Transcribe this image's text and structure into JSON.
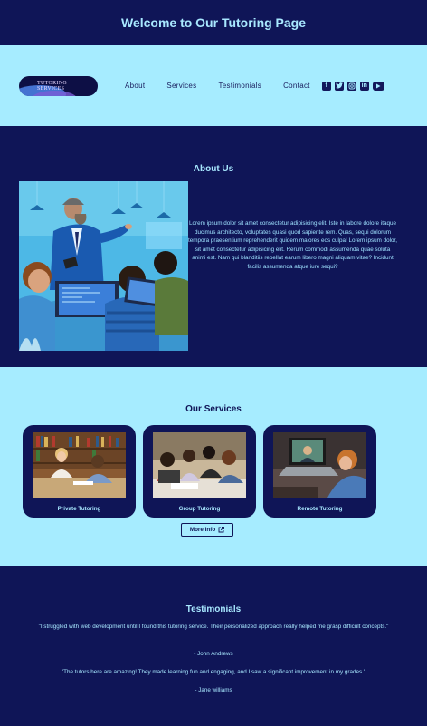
{
  "hero": {
    "title": "Welcome to Our Tutoring Page"
  },
  "nav": {
    "logo_line1": "TUTORING",
    "logo_line2": "SERVICES",
    "links": [
      "About",
      "Services",
      "Testimonials",
      "Contact"
    ],
    "socials": [
      "facebook-icon",
      "twitter-icon",
      "instagram-icon",
      "linkedin-icon",
      "youtube-icon"
    ]
  },
  "about": {
    "heading": "About Us",
    "text": "Lorem ipsum dolor sit amet consectetur adipisicing elit. Iste in labore dolore itaque ducimus architecto, voluptates quasi quod sapiente rem. Quas, sequi dolorum tempora praesentium reprehenderit quidem maiores eos culpa! Lorem ipsum dolor, sit amet consectetur adipisicing elit. Rerum commodi assumenda quae soluta animi est. Nam qui blanditiis repellat earum libero magni aliquam vitae? Incidunt facilis assumenda atque iure sequi?"
  },
  "services": {
    "heading": "Our Services",
    "cards": [
      {
        "label": "Private Tutoring"
      },
      {
        "label": "Group Tutoring"
      },
      {
        "label": "Remote Tutoring"
      }
    ],
    "more_label": "More Info"
  },
  "testimonials": {
    "heading": "Testimonials",
    "items": [
      {
        "quote": "\"I struggled with web development until I found this tutoring service. Their personalized approach really helped me grasp difficult concepts.\"",
        "author": "- John Andrews"
      },
      {
        "quote": "\"The tutors here are amazing! They made learning fun and engaging, and I saw a significant improvement in my grades.\"",
        "author": "- Jane williams"
      }
    ]
  },
  "colors": {
    "navy": "#0f1557",
    "light_blue": "#a6ecff",
    "accent_text": "#a8e8ff"
  }
}
